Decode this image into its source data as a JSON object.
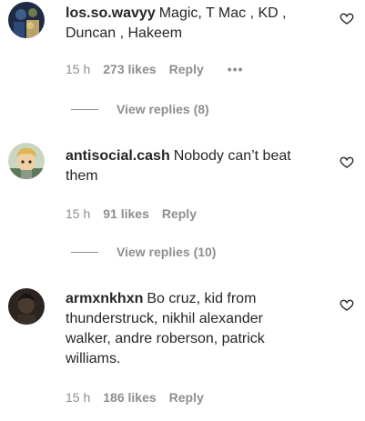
{
  "comments": [
    {
      "username": "los.so.wavyy",
      "text": "Magic, T Mac , KD , Duncan , Hakeem",
      "time": "15 h",
      "likes": "273 likes",
      "reply": "Reply",
      "more": "•••",
      "view_replies": "View replies (8)"
    },
    {
      "username": "antisocial.cash",
      "text": "Nobody can’t beat them",
      "time": "15 h",
      "likes": "91 likes",
      "reply": "Reply",
      "view_replies": "View replies (10)"
    },
    {
      "username": "armxnkhxn",
      "text": "Bo cruz, kid from thunderstruck, nikhil alexander walker, andre roberson, patrick williams.",
      "time": "15 h",
      "likes": "186 likes",
      "reply": "Reply"
    }
  ],
  "icons": {
    "heart": "heart-outline-icon",
    "more": "more-horizontal-icon"
  },
  "colors": {
    "text": "#262626",
    "secondary": "#8e8e8e"
  }
}
